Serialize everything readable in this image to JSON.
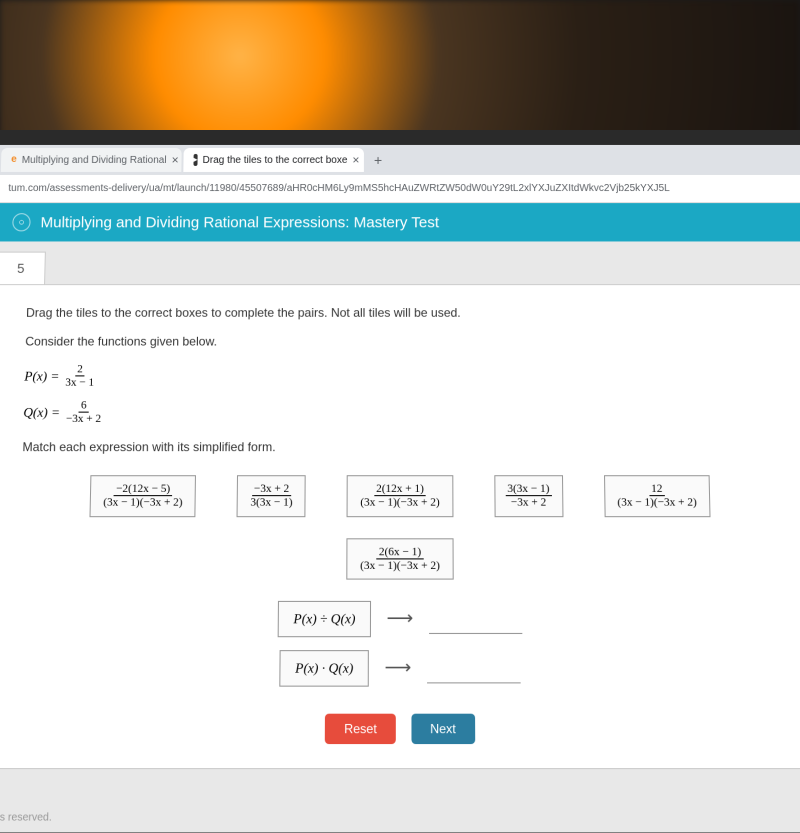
{
  "browser": {
    "tabs": [
      {
        "title": "Multiplying and Dividing Rational",
        "active": false
      },
      {
        "title": "Drag the tiles to the correct boxe",
        "active": true
      }
    ],
    "url": "tum.com/assessments-delivery/ua/mt/launch/11980/45507689/aHR0cHM6Ly9mMS5hcHAuZWRtZW50dW0uY29tL2xlYXJuZXItdWkvc2Vjb25kYXJ5L"
  },
  "header": {
    "title": "Multiplying and Dividing Rational Expressions: Mastery Test"
  },
  "question": {
    "number": "5",
    "instruction": "Drag the tiles to the correct boxes to complete the pairs. Not all tiles will be used.",
    "context": "Consider the functions given below.",
    "match_instruction": "Match each expression with its simplified form.",
    "p_label": "P(x) =",
    "p_num": "2",
    "p_den": "3x − 1",
    "q_label": "Q(x) =",
    "q_num": "6",
    "q_den": "−3x + 2"
  },
  "tiles": [
    {
      "num": "−2(12x − 5)",
      "den": "(3x − 1)(−3x + 2)"
    },
    {
      "num": "−3x + 2",
      "den": "3(3x − 1)"
    },
    {
      "num": "2(12x + 1)",
      "den": "(3x − 1)(−3x + 2)"
    },
    {
      "num": "3(3x − 1)",
      "den": "−3x + 2"
    },
    {
      "num": "12",
      "den": "(3x − 1)(−3x  + 2)"
    },
    {
      "num": "2(6x − 1)",
      "den": "(3x − 1)(−3x + 2)"
    }
  ],
  "matches": [
    {
      "label": "P(x) ÷ Q(x)"
    },
    {
      "label": "P(x) · Q(x)"
    }
  ],
  "buttons": {
    "reset": "Reset",
    "next": "Next"
  },
  "footer": "ghts reserved."
}
